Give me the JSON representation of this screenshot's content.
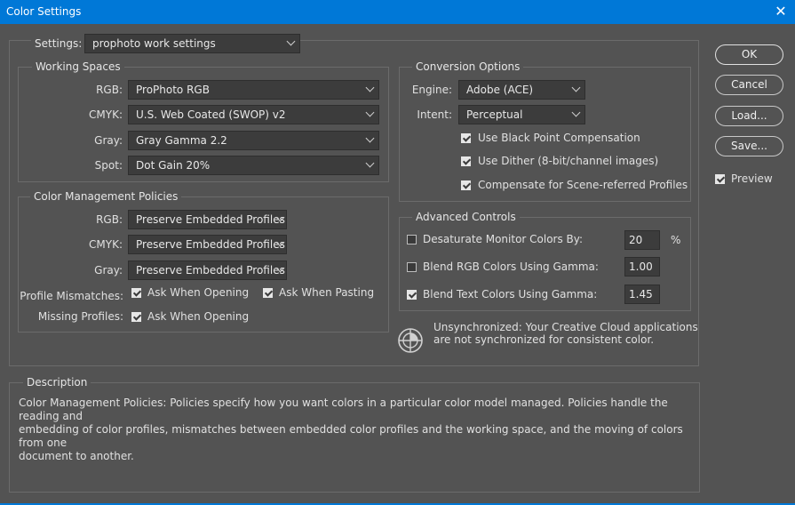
{
  "window": {
    "title": "Color Settings",
    "close_glyph": "✕"
  },
  "settings": {
    "label": "Settings:",
    "value": "prophoto work settings"
  },
  "working_spaces": {
    "title": "Working Spaces",
    "rgb": {
      "label": "RGB:",
      "value": "ProPhoto RGB"
    },
    "cmyk": {
      "label": "CMYK:",
      "value": "U.S. Web Coated (SWOP) v2"
    },
    "gray": {
      "label": "Gray:",
      "value": "Gray Gamma 2.2"
    },
    "spot": {
      "label": "Spot:",
      "value": "Dot Gain 20%"
    }
  },
  "policies": {
    "title": "Color Management Policies",
    "rgb": {
      "label": "RGB:",
      "value": "Preserve Embedded Profiles"
    },
    "cmyk": {
      "label": "CMYK:",
      "value": "Preserve Embedded Profiles"
    },
    "gray": {
      "label": "Gray:",
      "value": "Preserve Embedded Profiles"
    },
    "mismatches_label": "Profile Mismatches:",
    "ask_opening": {
      "label": "Ask When Opening",
      "checked": true
    },
    "ask_pasting": {
      "label": "Ask When Pasting",
      "checked": true
    },
    "missing_label": "Missing Profiles:",
    "missing_ask_opening": {
      "label": "Ask When Opening",
      "checked": true
    }
  },
  "conversion": {
    "title": "Conversion Options",
    "engine": {
      "label": "Engine:",
      "value": "Adobe (ACE)"
    },
    "intent": {
      "label": "Intent:",
      "value": "Perceptual"
    },
    "black_point": {
      "label": "Use Black Point Compensation",
      "checked": true
    },
    "dither": {
      "label": "Use Dither (8-bit/channel images)",
      "checked": true
    },
    "scene_referred": {
      "label": "Compensate for Scene-referred Profiles",
      "checked": true
    }
  },
  "advanced": {
    "title": "Advanced Controls",
    "desaturate": {
      "label": "Desaturate Monitor Colors By:",
      "value": "20",
      "unit": "%",
      "checked": false
    },
    "blend_rgb": {
      "label": "Blend RGB Colors Using Gamma:",
      "value": "1.00",
      "checked": false
    },
    "blend_text": {
      "label": "Blend Text Colors Using Gamma:",
      "value": "1.45",
      "checked": true
    }
  },
  "sync": {
    "icon": "color-sync-icon",
    "line1": "Unsynchronized: Your Creative Cloud applications",
    "line2": "are not synchronized for consistent color."
  },
  "description": {
    "title": "Description",
    "line1": "Color Management Policies:  Policies specify how you want colors in a particular color model managed.  Policies handle the reading and",
    "line2": "embedding of color profiles, mismatches between embedded color profiles and the working space, and the moving of colors from one",
    "line3": "document to another."
  },
  "buttons": {
    "ok": "OK",
    "cancel": "Cancel",
    "load": "Load...",
    "save": "Save..."
  },
  "preview": {
    "label": "Preview",
    "checked": true
  },
  "colors": {
    "titlebar": "#0078d7",
    "dialog_bg": "#535353",
    "field_bg": "#3c3c3c"
  }
}
